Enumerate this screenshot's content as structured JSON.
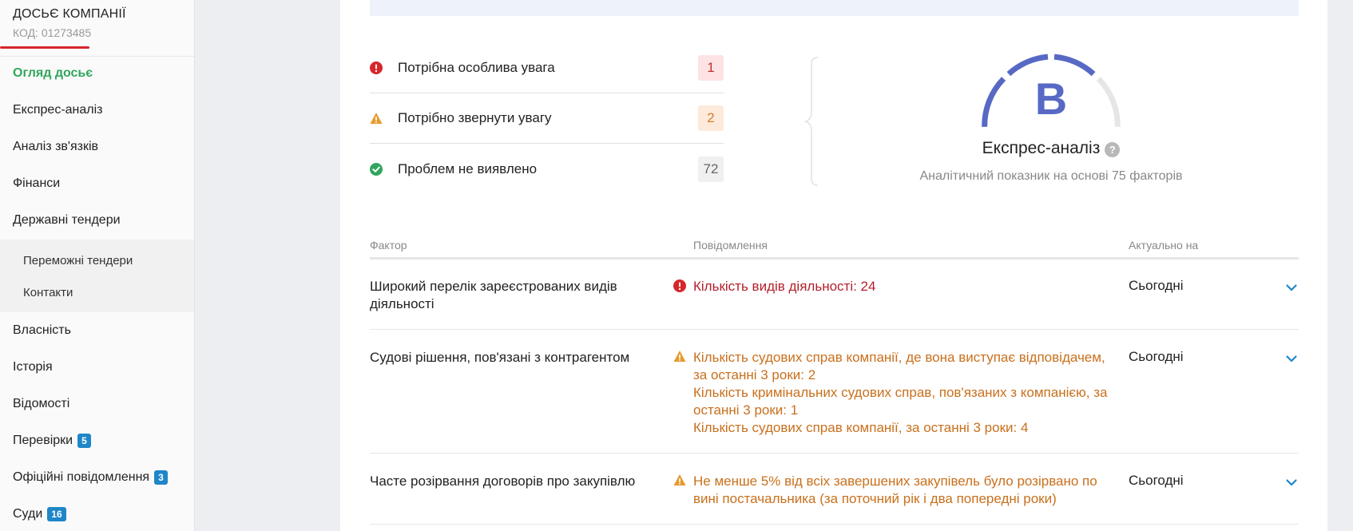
{
  "sidebar": {
    "title": "ДОСЬЄ КОМПАНІЇ",
    "code": "КОД: 01273485",
    "items": [
      {
        "label": "Огляд досьє"
      },
      {
        "label": "Експрес-аналіз"
      },
      {
        "label": "Аналіз зв'язків"
      },
      {
        "label": "Фінанси"
      },
      {
        "label": "Державні тендери"
      },
      {
        "label": "Власність"
      },
      {
        "label": "Історія"
      },
      {
        "label": "Відомості"
      },
      {
        "label": "Перевірки",
        "badge": "5"
      },
      {
        "label": "Офіційні повідомлення",
        "badge": "3"
      },
      {
        "label": "Суди",
        "badge": "16"
      }
    ],
    "subitems": [
      {
        "label": "Переможні тендери"
      },
      {
        "label": "Контакти"
      }
    ]
  },
  "summary": [
    {
      "label": "Потрібна особлива увага",
      "count": "1",
      "level": "critical"
    },
    {
      "label": "Потрібно звернути увагу",
      "count": "2",
      "level": "warning"
    },
    {
      "label": "Проблем не виявлено",
      "count": "72",
      "level": "ok"
    }
  ],
  "express": {
    "grade": "B",
    "title": "Експрес-аналіз",
    "help": "?",
    "subtitle": "Аналітичний показник на основі 75 факторів"
  },
  "table": {
    "headers": {
      "factor": "Фактор",
      "message": "Повідомлення",
      "date": "Актуально на"
    },
    "rows": [
      {
        "factor": "Широкий перелік зареєстрованих видів діяльності",
        "level": "critical",
        "messages": [
          "Кількість видів діяльності: 24"
        ],
        "date": "Сьогодні"
      },
      {
        "factor": "Судові рішення, пов'язані з контрагентом",
        "level": "warning",
        "messages": [
          "Кількість судових справ компанії, де вона виступає відповідачем, за останні 3 роки: 2",
          "Кількість кримінальних судових справ, пов'язаних з компанією, за останні 3 роки: 1",
          "Кількість судових справ компанії, за останні 3 роки: 4"
        ],
        "date": "Сьогодні"
      },
      {
        "factor": "Часте розірвання договорів про закупівлю",
        "level": "warning",
        "messages": [
          "Не менше 5% від всіх завершених закупівель було розірвано по вині постачальника (за поточний рік і два попередні роки)"
        ],
        "date": "Сьогодні"
      }
    ]
  },
  "colors": {
    "active": "#31a65d",
    "critical": "#d7262b",
    "warning": "#e69a2e",
    "ok": "#31a65d",
    "gauge": "#5769c4",
    "badge": "#1f86c8"
  }
}
